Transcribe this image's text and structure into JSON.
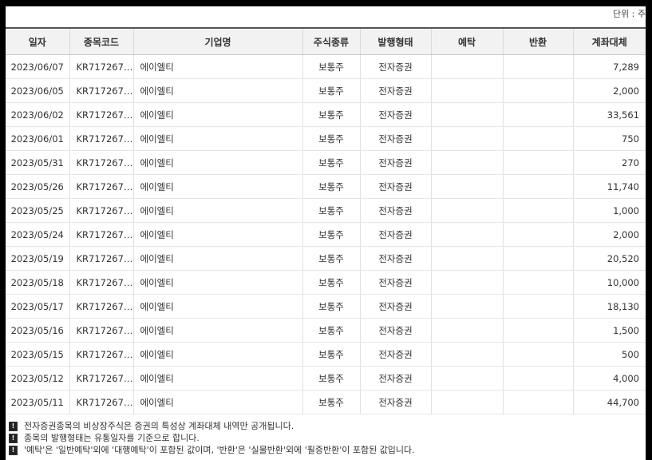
{
  "unit_label": "단위 : 주",
  "columns": [
    "일자",
    "종목코드",
    "기업명",
    "주식종류",
    "발행형태",
    "예탁",
    "반환",
    "계좌대체"
  ],
  "rows": [
    {
      "date": "2023/06/07",
      "code": "KR717267…",
      "company": "에이엘티",
      "stock_type": "보통주",
      "issue_type": "전자증권",
      "deposit": "",
      "return": "",
      "transfer": "7,289"
    },
    {
      "date": "2023/06/05",
      "code": "KR717267…",
      "company": "에이엘티",
      "stock_type": "보통주",
      "issue_type": "전자증권",
      "deposit": "",
      "return": "",
      "transfer": "2,000"
    },
    {
      "date": "2023/06/02",
      "code": "KR717267…",
      "company": "에이엘티",
      "stock_type": "보통주",
      "issue_type": "전자증권",
      "deposit": "",
      "return": "",
      "transfer": "33,561"
    },
    {
      "date": "2023/06/01",
      "code": "KR717267…",
      "company": "에이엘티",
      "stock_type": "보통주",
      "issue_type": "전자증권",
      "deposit": "",
      "return": "",
      "transfer": "750"
    },
    {
      "date": "2023/05/31",
      "code": "KR717267…",
      "company": "에이엘티",
      "stock_type": "보통주",
      "issue_type": "전자증권",
      "deposit": "",
      "return": "",
      "transfer": "270"
    },
    {
      "date": "2023/05/26",
      "code": "KR717267…",
      "company": "에이엘티",
      "stock_type": "보통주",
      "issue_type": "전자증권",
      "deposit": "",
      "return": "",
      "transfer": "11,740"
    },
    {
      "date": "2023/05/25",
      "code": "KR717267…",
      "company": "에이엘티",
      "stock_type": "보통주",
      "issue_type": "전자증권",
      "deposit": "",
      "return": "",
      "transfer": "1,000"
    },
    {
      "date": "2023/05/24",
      "code": "KR717267…",
      "company": "에이엘티",
      "stock_type": "보통주",
      "issue_type": "전자증권",
      "deposit": "",
      "return": "",
      "transfer": "2,000"
    },
    {
      "date": "2023/05/19",
      "code": "KR717267…",
      "company": "에이엘티",
      "stock_type": "보통주",
      "issue_type": "전자증권",
      "deposit": "",
      "return": "",
      "transfer": "20,520"
    },
    {
      "date": "2023/05/18",
      "code": "KR717267…",
      "company": "에이엘티",
      "stock_type": "보통주",
      "issue_type": "전자증권",
      "deposit": "",
      "return": "",
      "transfer": "10,000"
    },
    {
      "date": "2023/05/17",
      "code": "KR717267…",
      "company": "에이엘티",
      "stock_type": "보통주",
      "issue_type": "전자증권",
      "deposit": "",
      "return": "",
      "transfer": "18,130"
    },
    {
      "date": "2023/05/16",
      "code": "KR717267…",
      "company": "에이엘티",
      "stock_type": "보통주",
      "issue_type": "전자증권",
      "deposit": "",
      "return": "",
      "transfer": "1,500"
    },
    {
      "date": "2023/05/15",
      "code": "KR717267…",
      "company": "에이엘티",
      "stock_type": "보통주",
      "issue_type": "전자증권",
      "deposit": "",
      "return": "",
      "transfer": "500"
    },
    {
      "date": "2023/05/12",
      "code": "KR717267…",
      "company": "에이엘티",
      "stock_type": "보통주",
      "issue_type": "전자증권",
      "deposit": "",
      "return": "",
      "transfer": "4,000"
    },
    {
      "date": "2023/05/11",
      "code": "KR717267…",
      "company": "에이엘티",
      "stock_type": "보통주",
      "issue_type": "전자증권",
      "deposit": "",
      "return": "",
      "transfer": "44,700"
    }
  ],
  "notes": [
    "전자증권종목의 비상장주식은 증권의 특성상 계좌대체 내역만 공개됩니다.",
    "종목의 발행형태는 유통일자를 기준으로 합니다.",
    "'예탁'은 '일반예탁'외에 '대행예탁'이 포함된 값이며, '반환'은 '실물반환'외에 '필증반환'이 포함된 값입니다."
  ],
  "note_icon": "info-icon"
}
